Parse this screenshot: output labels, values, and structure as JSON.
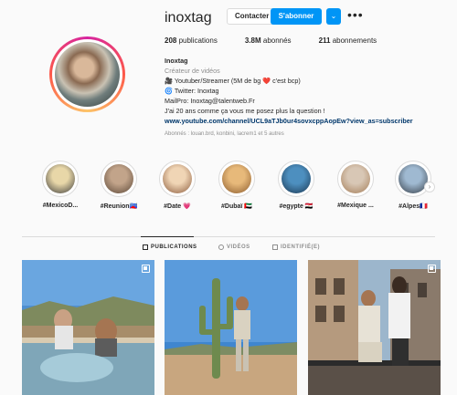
{
  "profile": {
    "username": "inoxtag",
    "verified_label": "✔",
    "contact_label": "Contacter",
    "follow_label": "S'abonner",
    "suggest_label": "⌄",
    "more_label": "•••",
    "stats": [
      {
        "value": "208",
        "label": " publications"
      },
      {
        "value": "3.8M",
        "label": " abonnés"
      },
      {
        "value": "211",
        "label": " abonnements"
      }
    ]
  },
  "bio": {
    "name": "Inoxtag",
    "category": "Créateur de vidéos",
    "lines": [
      "🎥 Youtuber/Streamer (5M de bg ❤️ c'est bcp)",
      "🌀 Twitter: Inoxtag",
      "MailPro: Inoxtag@talentweb.Fr",
      "J'ai 20 ans comme ça vous me posez plus la question !"
    ],
    "link": "www.youtube.com/channel/UCL9aTJb0ur4sovxcppAopEw?view_as=subscriber",
    "followed_by": "Abonnés : louan.brd, konbini, lacrem1 et 5 autres"
  },
  "highlights": [
    {
      "label": "#MexicoD...",
      "color1": "#e8d7a8",
      "color2": "#3a3a3a"
    },
    {
      "label": "#Reunion🇷🇪",
      "color1": "#c2a48a",
      "color2": "#5a4636"
    },
    {
      "label": "#Date 💗",
      "color1": "#f0d5b5",
      "color2": "#8a5a3c"
    },
    {
      "label": "#Dubaï 🇦🇪",
      "color1": "#e7b97a",
      "color2": "#8a5a2c"
    },
    {
      "label": "#egypte 🇪🇬",
      "color1": "#4d8fbf",
      "color2": "#1a3650"
    },
    {
      "label": "#Mexique ...",
      "color1": "#d8c7b5",
      "color2": "#a37b55"
    },
    {
      "label": "#Alpes🇫🇷",
      "color1": "#9fb9d1",
      "color2": "#343c45"
    }
  ],
  "tabs": [
    {
      "label": "PUBLICATIONS",
      "icon": "grid-icon",
      "active": true
    },
    {
      "label": "VIDÉOS",
      "icon": "video-icon",
      "active": false
    },
    {
      "label": "IDENTIFIÉ(E)",
      "icon": "tag-icon",
      "active": false
    }
  ],
  "posts": [
    {
      "icon": "multiple-posts-icon",
      "sky": "#4f8fd0",
      "ground": "#b79c7b"
    },
    {
      "icon": "none",
      "sky": "#3f86cf",
      "ground": "#c8a67f"
    },
    {
      "icon": "multiple-posts-icon",
      "sky": "#9cb6cc",
      "ground": "#8a7a6b"
    }
  ]
}
